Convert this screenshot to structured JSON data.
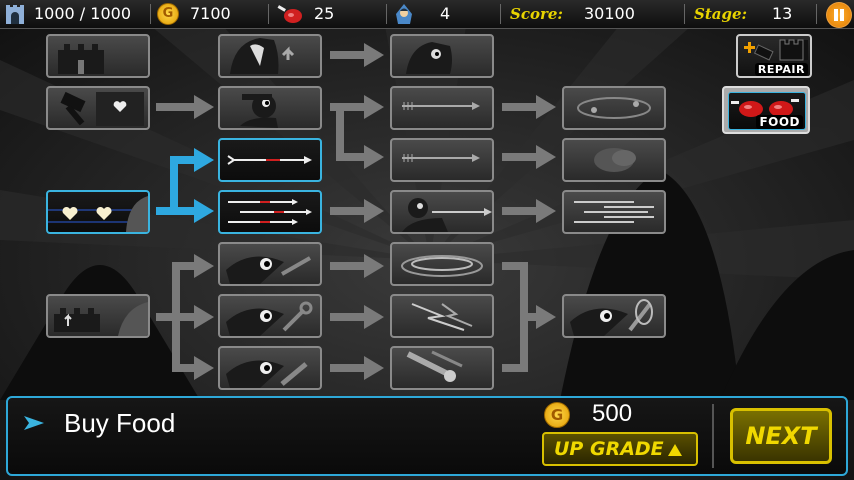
{
  "hud": {
    "hp": "1000 / 1000",
    "gold": "7100",
    "meat": "25",
    "units": "4",
    "score_label": "Score:",
    "score": "30100",
    "stage_label": "Stage:",
    "stage": "13"
  },
  "side_buttons": {
    "repair": "REPAIR",
    "food": "FOOD"
  },
  "panel": {
    "description": "Buy Food",
    "cost": "500",
    "upgrade_label": "UP GRADE",
    "next_label": "NEXT"
  },
  "colors": {
    "accent_blue": "#3ab4e0",
    "gold_yellow": "#e8d400",
    "background": "#1b1b1b"
  }
}
